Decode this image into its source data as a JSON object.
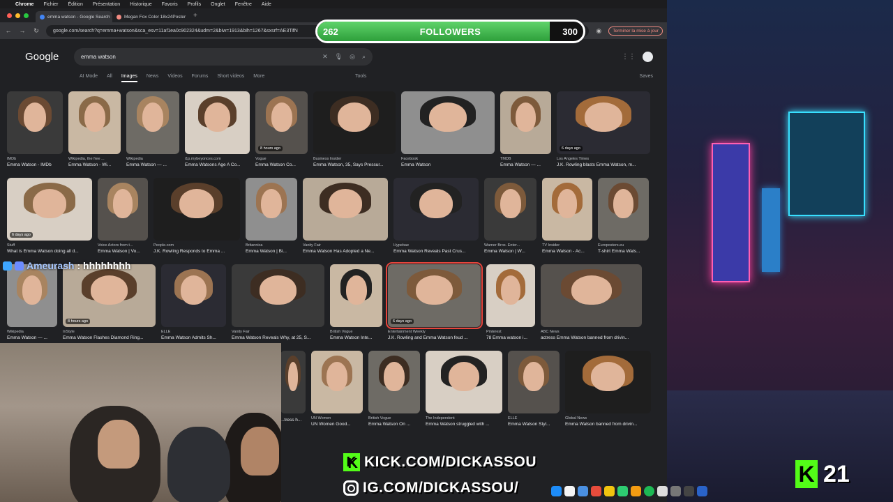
{
  "menubar": {
    "items": [
      "Chrome",
      "Fichier",
      "Édition",
      "Présentation",
      "Historique",
      "Favoris",
      "Profils",
      "Onglet",
      "Fenêtre",
      "Aide"
    ]
  },
  "tabs": [
    {
      "label": "emma watson - Google Search",
      "active": true
    },
    {
      "label": "Megan Fox Color 18x24Poster",
      "active": false
    }
  ],
  "address": {
    "url": "google.com/search?q=emma+watson&sca_esv=11af1ea0c902324&udm=2&biw=1913&bih=1267&sxsrf=AE3TifN",
    "update_label": "Terminer la mise à jour"
  },
  "followers": {
    "current": "262",
    "label": "FOLLOWERS",
    "goal": "300",
    "progress": 0.873
  },
  "google": {
    "logo": "Google",
    "query": "emma watson",
    "filters": [
      "AI Mode",
      "All",
      "Images",
      "News",
      "Videos",
      "Forums",
      "Short videos",
      "More"
    ],
    "active_filter": "Images",
    "tools": "Tools",
    "saves": "Saves"
  },
  "rows": [
    [
      {
        "src": "IMDb",
        "cap": "Emma Watson - IMDb",
        "w": 80
      },
      {
        "src": "Wikipedia, the free ...",
        "cap": "Emma Watson - Wi...",
        "w": 75
      },
      {
        "src": "Wikipedia",
        "cap": "Emma Watson — ...",
        "w": 76
      },
      {
        "src": "i1p.mybeyonces.com",
        "cap": "Emma Watsons Age A Co...",
        "w": 93
      },
      {
        "src": "Vogue",
        "cap": "Emma Watson Co...",
        "w": 75,
        "badge": "8 hours ago"
      },
      {
        "src": "Business Insider",
        "cap": "Emma Watson, 35, Says Pressur...",
        "w": 118
      },
      {
        "src": "Facebook",
        "cap": "Emma Watson",
        "w": 134
      },
      {
        "src": "TMDB",
        "cap": "Emma Watson — ...",
        "w": 73
      },
      {
        "src": "Los Angeles Times",
        "cap": "J.K. Rowling blasts Emma Watson, m...",
        "w": 134,
        "badge": "6 days ago"
      }
    ],
    [
      {
        "src": "Stuff",
        "cap": "What is Emma Watson doing all d...",
        "w": 122,
        "badge": "6 days ago"
      },
      {
        "src": "Voice Actors from t...",
        "cap": "Emma Watson | Vo...",
        "w": 72
      },
      {
        "src": "People.com",
        "cap": "J.K. Rowling Responds to Emma ...",
        "w": 124
      },
      {
        "src": "Britannica",
        "cap": "Emma Watson | Bi...",
        "w": 74
      },
      {
        "src": "Vanity Fair",
        "cap": "Emma Watson Has Adopted a Ne...",
        "w": 122
      },
      {
        "src": "Hypebae",
        "cap": "Emma Watson Reveals Past Crus...",
        "w": 122
      },
      {
        "src": "Warner Bros. Enter...",
        "cap": "Emma Watson | W...",
        "w": 75
      },
      {
        "src": "TV Insider",
        "cap": "Emma Watson - Ac...",
        "w": 72
      },
      {
        "src": "Europosters.eu",
        "cap": "T-shirt Emma Wats...",
        "w": 73
      }
    ],
    [
      {
        "src": "Wikipedia",
        "cap": "Emma Watson — ...",
        "w": 72
      },
      {
        "src": "InStyle",
        "cap": "Emma Watson Flashes Diamond Ring...",
        "w": 133,
        "badge": "8 hours ago"
      },
      {
        "src": "ELLE",
        "cap": "Emma Watson Admits Sh...",
        "w": 93
      },
      {
        "src": "Vanity Fair",
        "cap": "Emma Watson Reveals Why, at 25, S...",
        "w": 133
      },
      {
        "src": "British Vogue",
        "cap": "Emma Watson Inte...",
        "w": 75
      },
      {
        "src": "Entertainment Weekly",
        "cap": "J.K. Rowling and Emma Watson feud ...",
        "w": 133,
        "badge": "6 days ago",
        "selected": true
      },
      {
        "src": "Pinterest",
        "cap": "78 Emma watson i...",
        "w": 70
      },
      {
        "src": "ABC News",
        "cap": "actress Emma Watson banned from drivin...",
        "w": 145
      }
    ],
    [
      {
        "src": "",
        "cap": "...tress h...",
        "w": 36
      },
      {
        "src": "UN Women",
        "cap": "UN Women Good...",
        "w": 74
      },
      {
        "src": "British Vogue",
        "cap": "Emma Watson On ...",
        "w": 74
      },
      {
        "src": "The Independent",
        "cap": "Emma Watson struggled with ...",
        "w": 110
      },
      {
        "src": "ELLE",
        "cap": "Emma Watson Styl...",
        "w": 74
      },
      {
        "src": "Global News",
        "cap": "Emma Watson banned from drivin...",
        "w": 123
      }
    ]
  ],
  "chat": {
    "user": "Ameurash",
    "message": ": hhhhhhhh"
  },
  "kick": {
    "url": "KICK.COM/DICKASSOU"
  },
  "instagram": {
    "url": "IG.COM/DICKASSOU/"
  },
  "viewers": {
    "count": "21"
  }
}
